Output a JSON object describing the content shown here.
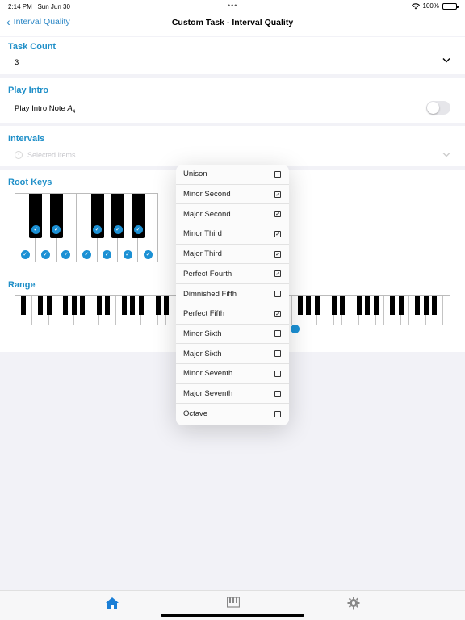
{
  "status": {
    "time": "2:14 PM",
    "date": "Sun Jun 30",
    "battery": "100%"
  },
  "nav": {
    "back_label": "Interval Quality",
    "title": "Custom Task - Interval Quality"
  },
  "task_count": {
    "title": "Task Count",
    "value": "3"
  },
  "play_intro": {
    "title": "Play Intro",
    "label": "Play Intro Note",
    "note": "A",
    "octave": "4",
    "enabled": false
  },
  "intervals": {
    "title": "Intervals",
    "placeholder": "Selected Items"
  },
  "root_keys": {
    "title": "Root Keys",
    "white_selected": [
      true,
      true,
      true,
      true,
      true,
      true,
      true
    ],
    "black_selected": [
      true,
      true,
      true,
      true,
      true
    ]
  },
  "range": {
    "title": "Range"
  },
  "interval_options": [
    {
      "label": "Unison",
      "checked": false
    },
    {
      "label": "Minor Second",
      "checked": true
    },
    {
      "label": "Major Second",
      "checked": true
    },
    {
      "label": "Minor Third",
      "checked": true
    },
    {
      "label": "Major Third",
      "checked": true
    },
    {
      "label": "Perfect Fourth",
      "checked": true
    },
    {
      "label": "Dimnished Fifth",
      "checked": false
    },
    {
      "label": "Perfect Fifth",
      "checked": true
    },
    {
      "label": "Minor Sixth",
      "checked": false
    },
    {
      "label": "Major Sixth",
      "checked": false
    },
    {
      "label": "Minor Seventh",
      "checked": false
    },
    {
      "label": "Major Seventh",
      "checked": false
    },
    {
      "label": "Octave",
      "checked": false
    }
  ],
  "tabs": [
    {
      "icon": "home-icon",
      "active": true
    },
    {
      "icon": "piano-icon",
      "active": false
    },
    {
      "icon": "gear-icon",
      "active": false
    }
  ],
  "colors": {
    "accent": "#1f8fc8",
    "check": "#1b90d4"
  }
}
